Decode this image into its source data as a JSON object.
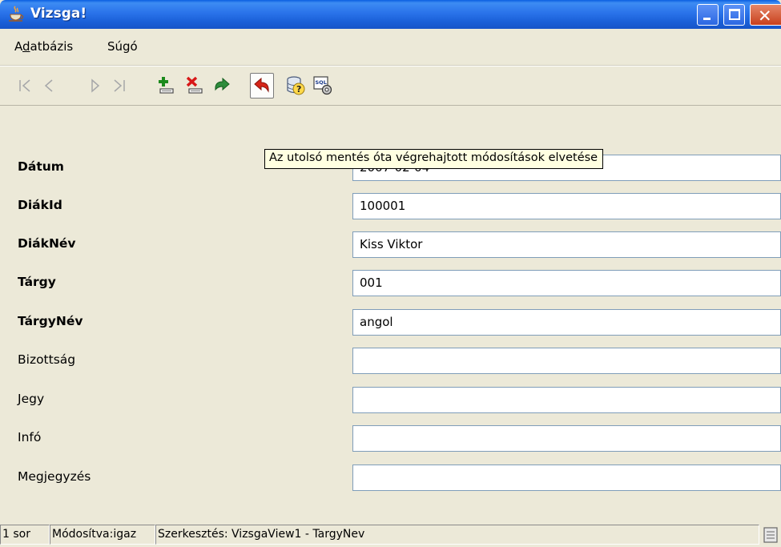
{
  "window": {
    "title": "Vizsga!",
    "controls": [
      "minimize-icon",
      "maximize-icon",
      "close-icon"
    ]
  },
  "menu": {
    "database_prefix": "A",
    "database_underlined": "d",
    "database_rest": "atbázis",
    "help": "Súgó"
  },
  "toolbar": {
    "buttons": [
      {
        "icon": "first-record-icon",
        "glyph": "|<",
        "enabled": false
      },
      {
        "icon": "previous-record-icon",
        "glyph": "<",
        "enabled": false
      },
      {
        "icon": "next-record-icon",
        "glyph": "▷",
        "enabled": false
      },
      {
        "icon": "last-record-icon",
        "glyph": ">|",
        "enabled": false
      },
      {
        "icon": "add-record-icon",
        "enabled": true
      },
      {
        "icon": "delete-record-icon",
        "enabled": true
      },
      {
        "icon": "save-changes-icon",
        "enabled": true
      },
      {
        "icon": "undo-changes-icon",
        "enabled": true,
        "pressed": true
      },
      {
        "icon": "query-help-icon",
        "enabled": true
      },
      {
        "icon": "sql-icon",
        "enabled": true
      }
    ],
    "tooltip": "Az utolsó mentés óta végrehajtott módosítások elvetése"
  },
  "form": {
    "fields": [
      {
        "label": "Dátum",
        "value": "2007-02-04",
        "bold": true
      },
      {
        "label": "DiákId",
        "value": "100001",
        "bold": true
      },
      {
        "label": "DiákNév",
        "value": "Kiss Viktor",
        "bold": true
      },
      {
        "label": "Tárgy",
        "value": "001",
        "bold": true
      },
      {
        "label": "TárgyNév",
        "value": "angol",
        "bold": true
      },
      {
        "label": "Bizottság",
        "value": "",
        "bold": false
      },
      {
        "label": "Jegy",
        "value": "",
        "bold": false
      },
      {
        "label": "Infó",
        "value": "",
        "bold": false
      },
      {
        "label": "Megjegyzés",
        "value": "",
        "bold": false
      }
    ]
  },
  "status": {
    "rows": "1 sor",
    "modified": "Módosítva:igaz",
    "editing": "Szerkesztés: VizsgaView1 - TargyNev"
  },
  "colors": {
    "titlebar": "#2a73ea",
    "tooltip_bg": "#ffffe1",
    "window_bg": "#ece9d8"
  }
}
